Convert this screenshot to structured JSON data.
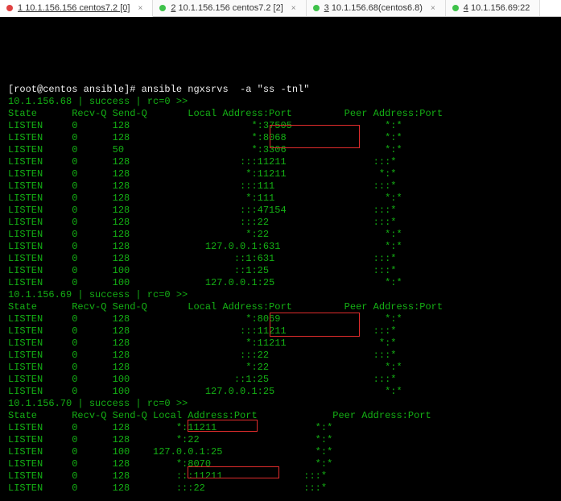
{
  "tabs": [
    {
      "num": "1",
      "label": "10.1.156.156 centos7.2 [0]",
      "dot": "red",
      "active": true
    },
    {
      "num": "2",
      "label": "10.1.156.156 centos7.2 [2]",
      "dot": "green",
      "active": false
    },
    {
      "num": "3",
      "label": "10.1.156.68(centos6.8)",
      "dot": "green",
      "active": false
    },
    {
      "num": "4",
      "label": "10.1.156.69:22",
      "dot": "green",
      "active": false
    }
  ],
  "prompt": "[root@centos ansible]# ",
  "command": "ansible ngxsrvs  -a \"ss -tnl\"",
  "hosts": [
    {
      "header": "10.1.156.68 | success | rc=0 >>",
      "colheader": "State      Recv-Q Send-Q       Local Address:Port         Peer Address:Port",
      "rows": [
        "LISTEN     0      128                     *:37505                *:*",
        "LISTEN     0      128                     *:8068                 *:*",
        "LISTEN     0      50                      *:3306                 *:*",
        "LISTEN     0      128                   :::11211               :::*",
        "LISTEN     0      128                    *:11211                *:*",
        "LISTEN     0      128                   :::111                 :::*",
        "LISTEN     0      128                    *:111                   *:*",
        "LISTEN     0      128                   :::47154               :::*",
        "LISTEN     0      128                   :::22                  :::*",
        "LISTEN     0      128                    *:22                    *:*",
        "LISTEN     0      128             127.0.0.1:631                  *:*",
        "LISTEN     0      128                  ::1:631                 :::*",
        "LISTEN     0      100                  ::1:25                  :::*",
        "LISTEN     0      100             127.0.0.1:25                   *:*"
      ]
    },
    {
      "header": "10.1.156.69 | success | rc=0 >>",
      "colheader": "State      Recv-Q Send-Q       Local Address:Port         Peer Address:Port",
      "rows": [
        "LISTEN     0      128                    *:8069                  *:*",
        "LISTEN     0      128                   :::11211               :::*",
        "LISTEN     0      128                    *:11211                *:*",
        "LISTEN     0      128                   :::22                  :::*",
        "LISTEN     0      128                    *:22                    *:*",
        "LISTEN     0      100                  ::1:25                  :::*",
        "LISTEN     0      100             127.0.0.1:25                   *:*"
      ]
    },
    {
      "header": "10.1.156.70 | success | rc=0 >>",
      "colheader": "State      Recv-Q Send-Q Local Address:Port             Peer Address:Port",
      "rows": [
        "LISTEN     0      128        *:11211                 *:*",
        "LISTEN     0      128        *:22                    *:*",
        "LISTEN     0      100    127.0.0.1:25                *:*",
        "LISTEN     0      128        *:8070                  *:*",
        "LISTEN     0      128        :::11211              :::*",
        "LISTEN     0      128        :::22                 :::*"
      ]
    }
  ]
}
